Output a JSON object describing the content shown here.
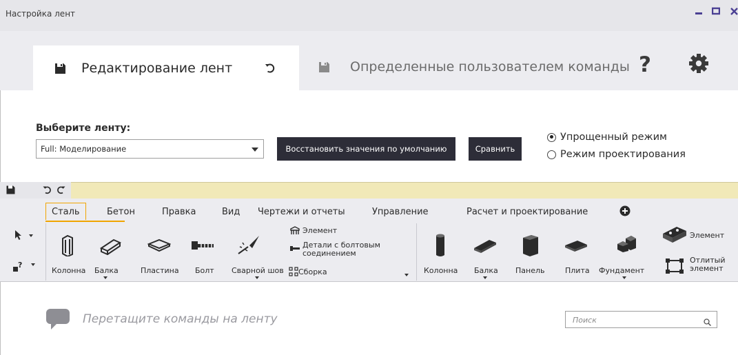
{
  "window": {
    "title": "Настройка лент",
    "controls": [
      "minimize",
      "maximize",
      "close"
    ]
  },
  "main_tabs": [
    {
      "label": "Редактирование лент",
      "icon": "save-icon",
      "active": true
    },
    {
      "label": "Определенные пользователем команды",
      "icon": "save-icon",
      "active": false
    }
  ],
  "header_icons": [
    "undo-icon",
    "help-icon",
    "settings-gear-icon"
  ],
  "ribbon_select": {
    "label": "Выберите ленту:",
    "value": "Full: Моделирование",
    "restore_button": "Восстановить значения по умолчанию",
    "compare_button": "Сравнить"
  },
  "modes": [
    {
      "label": "Упрощенный режим",
      "selected": true
    },
    {
      "label": "Режим проектирования",
      "selected": false
    }
  ],
  "quick_access_icons": [
    "save-icon",
    "undo-icon",
    "redo-icon"
  ],
  "ribbon_tabs": [
    "Сталь",
    "Бетон",
    "Правка",
    "Вид",
    "Чертежи и отчеты",
    "Управление",
    "Расчет и проектирование"
  ],
  "active_ribbon_tab": "Сталь",
  "steel_commands": {
    "column": "Колонна",
    "beam": "Балка",
    "plate": "Пластина",
    "bolt": "Болт",
    "weld": "Сварной шов",
    "element": "Элемент",
    "bolted_details": "Детали с болтовым соединением",
    "assembly": "Сборка"
  },
  "concrete_commands": {
    "column": "Колонна",
    "beam": "Балка",
    "panel": "Панель",
    "slab": "Плита",
    "foundation": "Фундамент",
    "element": "Элемент",
    "cast_element": "Отлитый элемент"
  },
  "drop_hint": "Перетащите команды на ленту",
  "search": {
    "placeholder": "Поиск"
  },
  "colors": {
    "accent": "#f0a500",
    "dark_button": "#2d2d38",
    "quick_access_bar": "#f1e9b8",
    "titlebar_icons": "#4a3f93"
  }
}
